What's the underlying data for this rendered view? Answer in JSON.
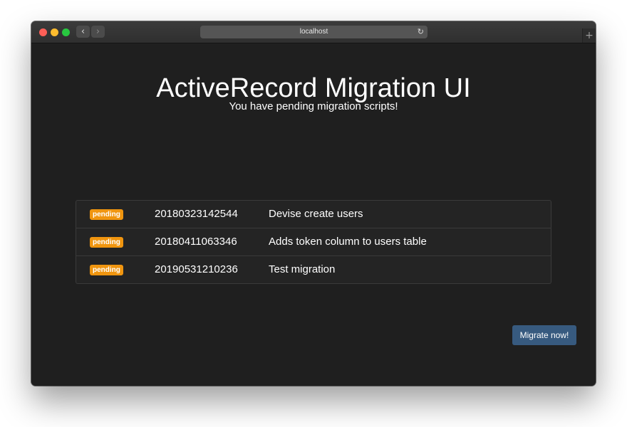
{
  "browser": {
    "url": "localhost",
    "back_icon": "‹",
    "forward_icon": "›",
    "reload_icon": "↻",
    "new_tab_icon": "+"
  },
  "page": {
    "title": "ActiveRecord Migration UI",
    "subtitle": "You have pending migration scripts!"
  },
  "migrations": [
    {
      "status": "pending",
      "version": "20180323142544",
      "name": "Devise create users"
    },
    {
      "status": "pending",
      "version": "20180411063346",
      "name": "Adds token column to users table"
    },
    {
      "status": "pending",
      "version": "20190531210236",
      "name": "Test migration"
    }
  ],
  "actions": {
    "migrate_label": "Migrate now!"
  },
  "colors": {
    "background": "#1f1f1f",
    "pending_badge": "#f0950f",
    "primary_button": "#375a7f"
  }
}
